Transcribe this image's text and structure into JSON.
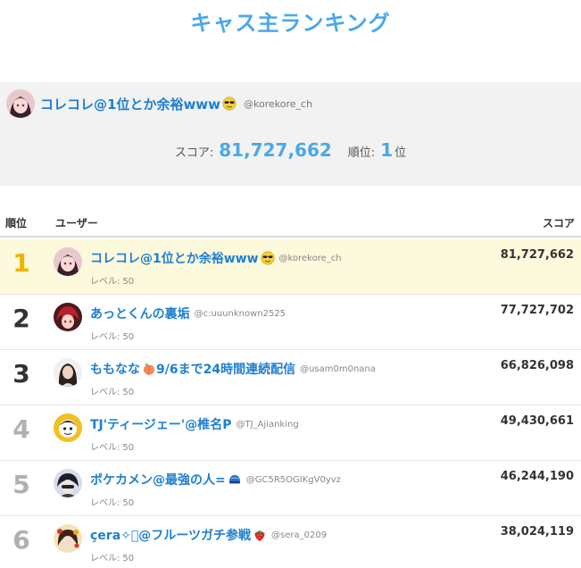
{
  "title": "キャス主ランキング",
  "me": {
    "name": "コレコレ@1位とか余裕www",
    "handle": "@korekore_ch",
    "score_label": "スコア:",
    "score": "81,727,662",
    "rank_label": "順位:",
    "rank": "1",
    "rank_unit": "位",
    "emoji": "sunglasses-face-icon"
  },
  "table": {
    "headers": {
      "rank": "順位",
      "user": "ユーザー",
      "score": "スコア"
    },
    "level_label": "レベル:",
    "rows": [
      {
        "rank": "1",
        "name": "コレコレ@1位とか余裕www",
        "emoji": "sunglasses-face-icon",
        "suffix": "",
        "handle": "@korekore_ch",
        "level": "50",
        "score": "81,727,662"
      },
      {
        "rank": "2",
        "name": "あっとくんの裏垢",
        "emoji": "",
        "suffix": "",
        "handle": "@c:uuunknown2525",
        "level": "50",
        "score": "77,727,702"
      },
      {
        "rank": "3",
        "name": "ももなな",
        "emoji": "peach-icon",
        "suffix": "9/6まで24時間連続配信",
        "handle": "@usam0m0nana",
        "level": "50",
        "score": "66,826,098"
      },
      {
        "rank": "4",
        "name": "TJ'ティージェー'@椎名P",
        "emoji": "",
        "suffix": "",
        "handle": "@TJ_Ajianking",
        "level": "50",
        "score": "49,430,661"
      },
      {
        "rank": "5",
        "name": "ポケカメン@最強の人=",
        "emoji": "helmet-icon",
        "suffix": "",
        "handle": "@GC5R5OGIKgV0yvz",
        "level": "50",
        "score": "46,244,190"
      },
      {
        "rank": "6",
        "name": "çera✧゚@フルーツガチ参戦",
        "emoji": "strawberry-icon",
        "suffix": "",
        "handle": "@sera_0209",
        "level": "50",
        "score": "38,024,119"
      }
    ]
  }
}
